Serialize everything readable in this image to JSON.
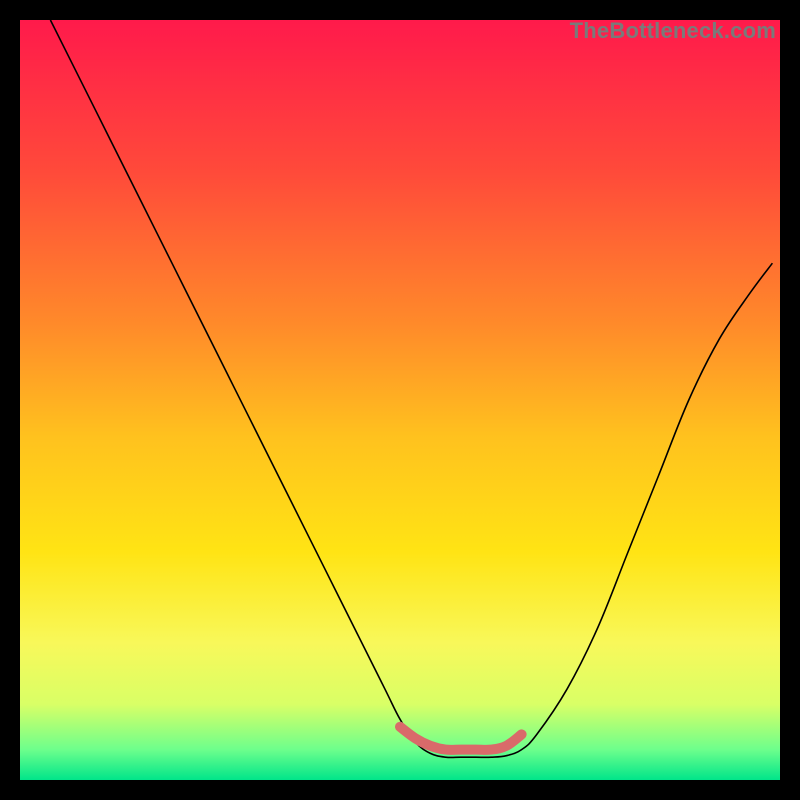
{
  "watermark": "TheBottleneck.com",
  "chart_data": {
    "type": "line",
    "title": "",
    "xlabel": "",
    "ylabel": "",
    "xlim": [
      0,
      100
    ],
    "ylim": [
      0,
      100
    ],
    "background_gradient_stops": [
      {
        "offset": 0.0,
        "color": "#ff1a4b"
      },
      {
        "offset": 0.2,
        "color": "#ff4a3a"
      },
      {
        "offset": 0.4,
        "color": "#ff8a2a"
      },
      {
        "offset": 0.55,
        "color": "#ffc21e"
      },
      {
        "offset": 0.7,
        "color": "#ffe414"
      },
      {
        "offset": 0.82,
        "color": "#f8f85a"
      },
      {
        "offset": 0.9,
        "color": "#d9ff66"
      },
      {
        "offset": 0.96,
        "color": "#6dff8c"
      },
      {
        "offset": 1.0,
        "color": "#00e58a"
      }
    ],
    "series": [
      {
        "name": "curve",
        "color": "#000000",
        "width": 1.6,
        "x": [
          4,
          8,
          12,
          16,
          20,
          24,
          28,
          32,
          36,
          40,
          44,
          48,
          50,
          52,
          54,
          56,
          58,
          60,
          62,
          64,
          66,
          68,
          72,
          76,
          80,
          84,
          88,
          92,
          96,
          99
        ],
        "y": [
          100,
          92,
          84,
          76,
          68,
          60,
          52,
          44,
          36,
          28,
          20,
          12,
          8,
          5,
          3.5,
          3,
          3,
          3,
          3,
          3.2,
          4,
          6,
          12,
          20,
          30,
          40,
          50,
          58,
          64,
          68
        ]
      }
    ],
    "marker_band": {
      "name": "optimal-band",
      "color": "#d96a6a",
      "width": 10,
      "cap": "round",
      "x": [
        50,
        52,
        54,
        56,
        58,
        60,
        62,
        64,
        66
      ],
      "y": [
        7,
        5.5,
        4.5,
        4,
        4,
        4,
        4,
        4.5,
        6
      ]
    }
  }
}
